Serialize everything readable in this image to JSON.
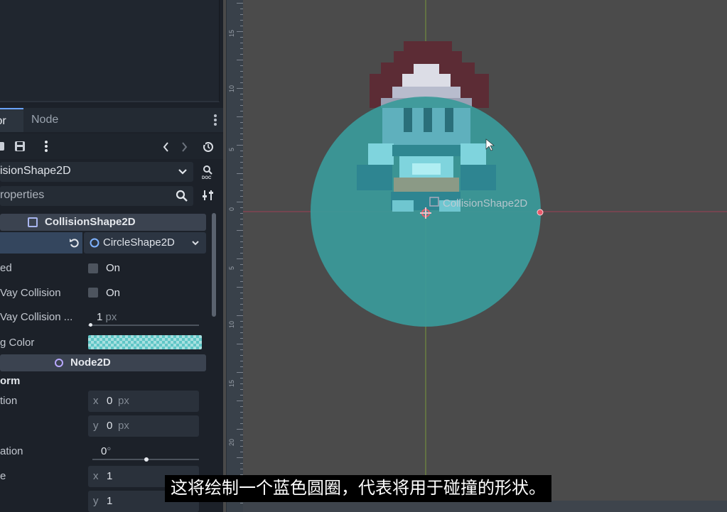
{
  "inspector": {
    "tabs": [
      "tor",
      "Node"
    ],
    "object_name": "isionShape2D",
    "filter_placeholder": "roperties",
    "sections": {
      "collision": "CollisionShape2D",
      "node2d": "Node2D",
      "transform": "orm"
    },
    "shape_value": "CircleShape2D",
    "rows": {
      "disabled": {
        "label": "ed",
        "value": "On"
      },
      "one_way": {
        "label": "Vay Collision",
        "value": "On"
      },
      "one_way_margin": {
        "label": "Vay Collision ...",
        "value": "1",
        "unit": "px",
        "fill": 0.02
      },
      "debug_color": {
        "label": "g Color",
        "color": "#5fc6c6"
      },
      "position": {
        "label": "tion",
        "x": "0",
        "y": "0",
        "unit": "px"
      },
      "rotation": {
        "label": "ation",
        "value": "0",
        "unit": "°",
        "fill": 0.5
      },
      "scale": {
        "label": "e",
        "x": "1",
        "y": "1"
      }
    },
    "axis_x": "x",
    "axis_y": "y"
  },
  "viewport": {
    "ruler_numbers": [
      "15",
      "10",
      "5",
      "0",
      "5",
      "10",
      "15",
      "20",
      "25",
      "30",
      "35"
    ],
    "node_label": "CollisionShape2D",
    "colors": {
      "collision_fill": "#3f9c9c",
      "axis_red": "#c03a5a",
      "axis_green": "#9acd32"
    }
  },
  "subtitle": "这将绘制一个蓝色圆圈，代表将用于碰撞的形状。",
  "icons": [
    "save-icon",
    "kebab-icon",
    "back-icon",
    "forward-icon",
    "history-icon",
    "chevron-down-icon",
    "doc-icon",
    "search-icon",
    "filter-settings-icon",
    "revert-icon",
    "circle-icon",
    "square-icon"
  ]
}
